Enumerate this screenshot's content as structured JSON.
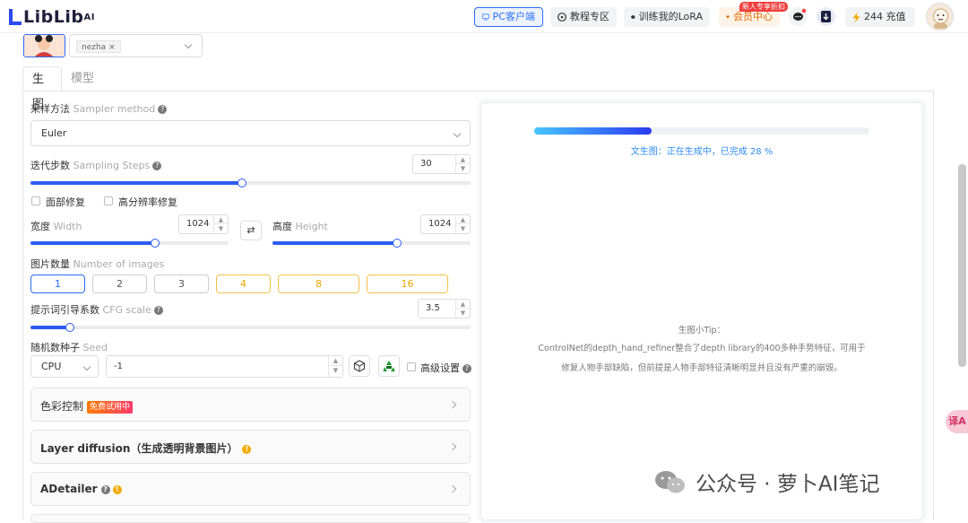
{
  "header": {
    "logo_text": "LibLib",
    "logo_sup": "AI",
    "pc_client": "PC客户端",
    "tutorial": "教程专区",
    "train_lora": "训练我的LoRA",
    "vip": "会员中心",
    "vip_tag": "新人专享折扣",
    "points": "244 充值"
  },
  "top_form": {
    "tag": "nezha"
  },
  "tabs": [
    {
      "label": "生图"
    },
    {
      "label": "模型"
    }
  ],
  "sampler": {
    "label": "采样方法",
    "label_en": "Sampler method",
    "value": "Euler"
  },
  "steps": {
    "label": "迭代步数",
    "label_en": "Sampling Steps",
    "value": "30",
    "fraction": 0.48
  },
  "options": {
    "face_fix": "面部修复",
    "hires_fix": "高分辨率修复"
  },
  "width": {
    "label": "宽度",
    "label_en": "Width",
    "value": "1024",
    "fraction": 0.63
  },
  "height": {
    "label": "高度",
    "label_en": "Height",
    "value": "1024",
    "fraction": 0.63
  },
  "swap_icon": "⇄",
  "image_count": {
    "label": "图片数量",
    "label_en": "Number of images",
    "options": [
      "1",
      "2",
      "3",
      "4",
      "8",
      "16"
    ]
  },
  "cfg": {
    "label": "提示词引导系数",
    "label_en": "CFG scale",
    "value": "3.5",
    "fraction": 0.09
  },
  "seed": {
    "label": "随机数种子",
    "label_en": "Seed",
    "device": "CPU",
    "value": "-1",
    "advanced": "高级设置"
  },
  "sections": [
    {
      "title": "色彩控制",
      "badge": "免费试用中"
    },
    {
      "title": "Layer diffusion（生成透明背景图片）"
    },
    {
      "title": "ADetailer"
    }
  ],
  "preview": {
    "progress": 0.35,
    "status": "文生图：正在生成中，已完成 28 %",
    "tip_title": "生图小Tip：",
    "tip_line1": "ControlNet的depth_hand_refiner整合了depth library的400多种手势特征，可用于",
    "tip_line2": "修复人物手部缺陷，但前提是人物手部特征清晰明显并且没有严重的崩毁。"
  },
  "translate_label": "译A",
  "watermark": "公众号 · 萝卜AI笔记",
  "colors": {
    "accent": "#2b5bf2",
    "progress_start": "#46c5ff",
    "progress_end": "#2b3bf2",
    "gold": "#f2c14e"
  }
}
